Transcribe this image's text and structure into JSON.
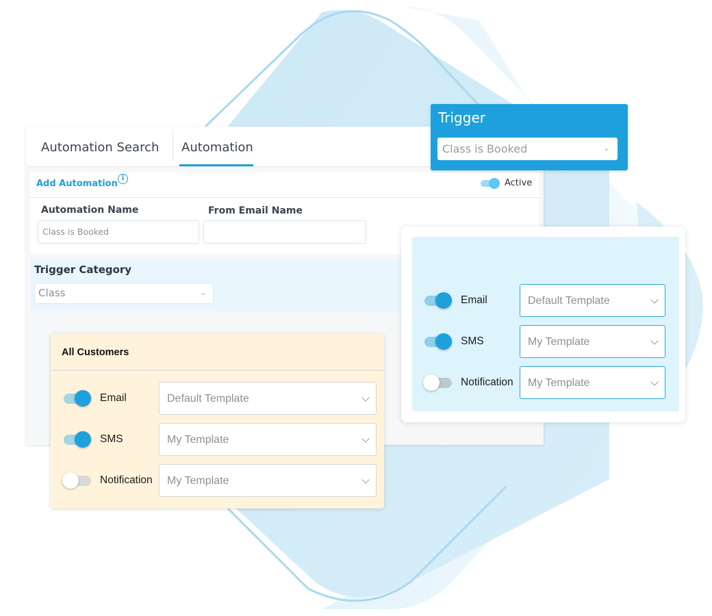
{
  "colors": {
    "accent": "#1ea0dc",
    "trigger_bg": "#1ea0dc",
    "light_blue_panel": "#def4fd",
    "yellow_panel": "#fff4db"
  },
  "tabs": [
    {
      "label": "Automation Search",
      "active": false
    },
    {
      "label": "Automation",
      "active": true
    }
  ],
  "add_automation": {
    "title": "Add Automation",
    "info_icon": "info-icon",
    "info_glyph": "i",
    "active_label": "Active",
    "active_on": true
  },
  "fields": {
    "automation_name": {
      "label": "Automation Name",
      "placeholder": "Class is Booked",
      "value": ""
    },
    "from_email_name": {
      "label": "From Email Name",
      "placeholder": "",
      "value": ""
    }
  },
  "trigger_category": {
    "label": "Trigger Category",
    "selected": "Class",
    "chevron": "⌄"
  },
  "trigger_card": {
    "title": "Trigger",
    "selected": "Class is Booked",
    "chevron": "⌄"
  },
  "all_customers_card": {
    "title": "All Customers",
    "rows": [
      {
        "label": "Email",
        "enabled": true,
        "template": "Default Template"
      },
      {
        "label": "SMS",
        "enabled": true,
        "template": "My Template"
      },
      {
        "label": "Notification",
        "enabled": false,
        "template": "My Template"
      }
    ]
  },
  "right_card": {
    "rows": [
      {
        "label": "Email",
        "enabled": true,
        "template": "Default Template"
      },
      {
        "label": "SMS",
        "enabled": true,
        "template": "My Template"
      },
      {
        "label": "Notification",
        "enabled": false,
        "template": "My Template"
      }
    ]
  }
}
